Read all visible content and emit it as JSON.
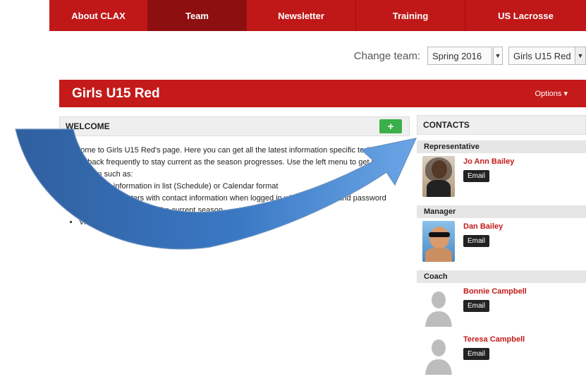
{
  "nav": {
    "items": [
      {
        "label": "About CLAX"
      },
      {
        "label": "Team"
      },
      {
        "label": "Newsletter"
      },
      {
        "label": "Training"
      },
      {
        "label": "US Lacrosse"
      }
    ]
  },
  "change_team": {
    "label": "Change team:",
    "season": "Spring 2016",
    "team": "Girls U15 Red"
  },
  "team_header": {
    "title": "Girls U15 Red",
    "options": "Options ▾"
  },
  "welcome": {
    "heading": "WELCOME",
    "add_label": "+",
    "para": "Welcome to Girls U15 Red's page. Here you can get all the latest information specific to this Team. Check back frequently to stay current as the season progresses. Use the left menu to get specific information such as:",
    "bullets": [
      "Schedule information in list (Schedule) or Calendar format",
      "View team Rosters with contact information when logged in with your email and password",
      "View game Results for the current season",
      "View team schedules for specific Teams (Multi-Schedule)"
    ]
  },
  "contacts": {
    "heading": "CONTACTS",
    "email_label": "Email",
    "groups": [
      {
        "role": "Representative",
        "people": [
          "Jo Ann Bailey"
        ]
      },
      {
        "role": "Manager",
        "people": [
          "Dan Bailey"
        ]
      },
      {
        "role": "Coach",
        "people": [
          "Bonnie Campbell",
          "Teresa Campbell"
        ]
      }
    ]
  },
  "colors": {
    "brand_red": "#c41a1a",
    "add_green": "#3bb04a",
    "arrow_blue": "#3f7fd0"
  }
}
